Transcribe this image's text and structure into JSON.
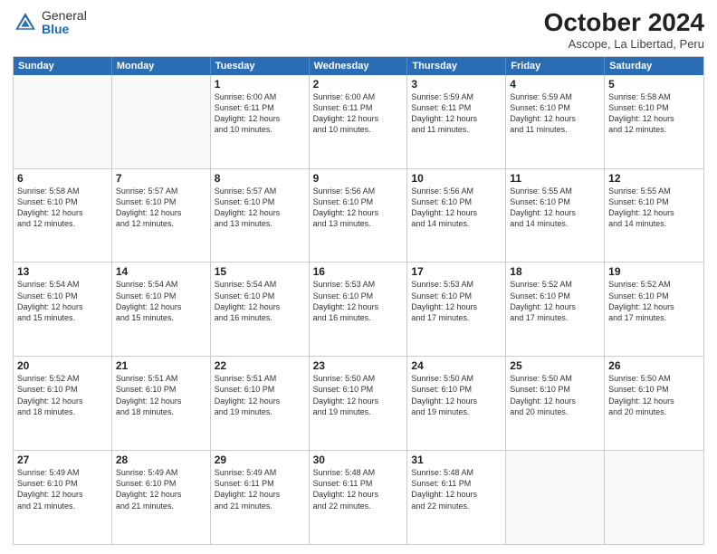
{
  "logo": {
    "general": "General",
    "blue": "Blue"
  },
  "title": "October 2024",
  "subtitle": "Ascope, La Libertad, Peru",
  "headers": [
    "Sunday",
    "Monday",
    "Tuesday",
    "Wednesday",
    "Thursday",
    "Friday",
    "Saturday"
  ],
  "weeks": [
    [
      {
        "day": "",
        "info": ""
      },
      {
        "day": "",
        "info": ""
      },
      {
        "day": "1",
        "info": "Sunrise: 6:00 AM\nSunset: 6:11 PM\nDaylight: 12 hours\nand 10 minutes."
      },
      {
        "day": "2",
        "info": "Sunrise: 6:00 AM\nSunset: 6:11 PM\nDaylight: 12 hours\nand 10 minutes."
      },
      {
        "day": "3",
        "info": "Sunrise: 5:59 AM\nSunset: 6:11 PM\nDaylight: 12 hours\nand 11 minutes."
      },
      {
        "day": "4",
        "info": "Sunrise: 5:59 AM\nSunset: 6:10 PM\nDaylight: 12 hours\nand 11 minutes."
      },
      {
        "day": "5",
        "info": "Sunrise: 5:58 AM\nSunset: 6:10 PM\nDaylight: 12 hours\nand 12 minutes."
      }
    ],
    [
      {
        "day": "6",
        "info": "Sunrise: 5:58 AM\nSunset: 6:10 PM\nDaylight: 12 hours\nand 12 minutes."
      },
      {
        "day": "7",
        "info": "Sunrise: 5:57 AM\nSunset: 6:10 PM\nDaylight: 12 hours\nand 12 minutes."
      },
      {
        "day": "8",
        "info": "Sunrise: 5:57 AM\nSunset: 6:10 PM\nDaylight: 12 hours\nand 13 minutes."
      },
      {
        "day": "9",
        "info": "Sunrise: 5:56 AM\nSunset: 6:10 PM\nDaylight: 12 hours\nand 13 minutes."
      },
      {
        "day": "10",
        "info": "Sunrise: 5:56 AM\nSunset: 6:10 PM\nDaylight: 12 hours\nand 14 minutes."
      },
      {
        "day": "11",
        "info": "Sunrise: 5:55 AM\nSunset: 6:10 PM\nDaylight: 12 hours\nand 14 minutes."
      },
      {
        "day": "12",
        "info": "Sunrise: 5:55 AM\nSunset: 6:10 PM\nDaylight: 12 hours\nand 14 minutes."
      }
    ],
    [
      {
        "day": "13",
        "info": "Sunrise: 5:54 AM\nSunset: 6:10 PM\nDaylight: 12 hours\nand 15 minutes."
      },
      {
        "day": "14",
        "info": "Sunrise: 5:54 AM\nSunset: 6:10 PM\nDaylight: 12 hours\nand 15 minutes."
      },
      {
        "day": "15",
        "info": "Sunrise: 5:54 AM\nSunset: 6:10 PM\nDaylight: 12 hours\nand 16 minutes."
      },
      {
        "day": "16",
        "info": "Sunrise: 5:53 AM\nSunset: 6:10 PM\nDaylight: 12 hours\nand 16 minutes."
      },
      {
        "day": "17",
        "info": "Sunrise: 5:53 AM\nSunset: 6:10 PM\nDaylight: 12 hours\nand 17 minutes."
      },
      {
        "day": "18",
        "info": "Sunrise: 5:52 AM\nSunset: 6:10 PM\nDaylight: 12 hours\nand 17 minutes."
      },
      {
        "day": "19",
        "info": "Sunrise: 5:52 AM\nSunset: 6:10 PM\nDaylight: 12 hours\nand 17 minutes."
      }
    ],
    [
      {
        "day": "20",
        "info": "Sunrise: 5:52 AM\nSunset: 6:10 PM\nDaylight: 12 hours\nand 18 minutes."
      },
      {
        "day": "21",
        "info": "Sunrise: 5:51 AM\nSunset: 6:10 PM\nDaylight: 12 hours\nand 18 minutes."
      },
      {
        "day": "22",
        "info": "Sunrise: 5:51 AM\nSunset: 6:10 PM\nDaylight: 12 hours\nand 19 minutes."
      },
      {
        "day": "23",
        "info": "Sunrise: 5:50 AM\nSunset: 6:10 PM\nDaylight: 12 hours\nand 19 minutes."
      },
      {
        "day": "24",
        "info": "Sunrise: 5:50 AM\nSunset: 6:10 PM\nDaylight: 12 hours\nand 19 minutes."
      },
      {
        "day": "25",
        "info": "Sunrise: 5:50 AM\nSunset: 6:10 PM\nDaylight: 12 hours\nand 20 minutes."
      },
      {
        "day": "26",
        "info": "Sunrise: 5:50 AM\nSunset: 6:10 PM\nDaylight: 12 hours\nand 20 minutes."
      }
    ],
    [
      {
        "day": "27",
        "info": "Sunrise: 5:49 AM\nSunset: 6:10 PM\nDaylight: 12 hours\nand 21 minutes."
      },
      {
        "day": "28",
        "info": "Sunrise: 5:49 AM\nSunset: 6:10 PM\nDaylight: 12 hours\nand 21 minutes."
      },
      {
        "day": "29",
        "info": "Sunrise: 5:49 AM\nSunset: 6:11 PM\nDaylight: 12 hours\nand 21 minutes."
      },
      {
        "day": "30",
        "info": "Sunrise: 5:48 AM\nSunset: 6:11 PM\nDaylight: 12 hours\nand 22 minutes."
      },
      {
        "day": "31",
        "info": "Sunrise: 5:48 AM\nSunset: 6:11 PM\nDaylight: 12 hours\nand 22 minutes."
      },
      {
        "day": "",
        "info": ""
      },
      {
        "day": "",
        "info": ""
      }
    ]
  ]
}
